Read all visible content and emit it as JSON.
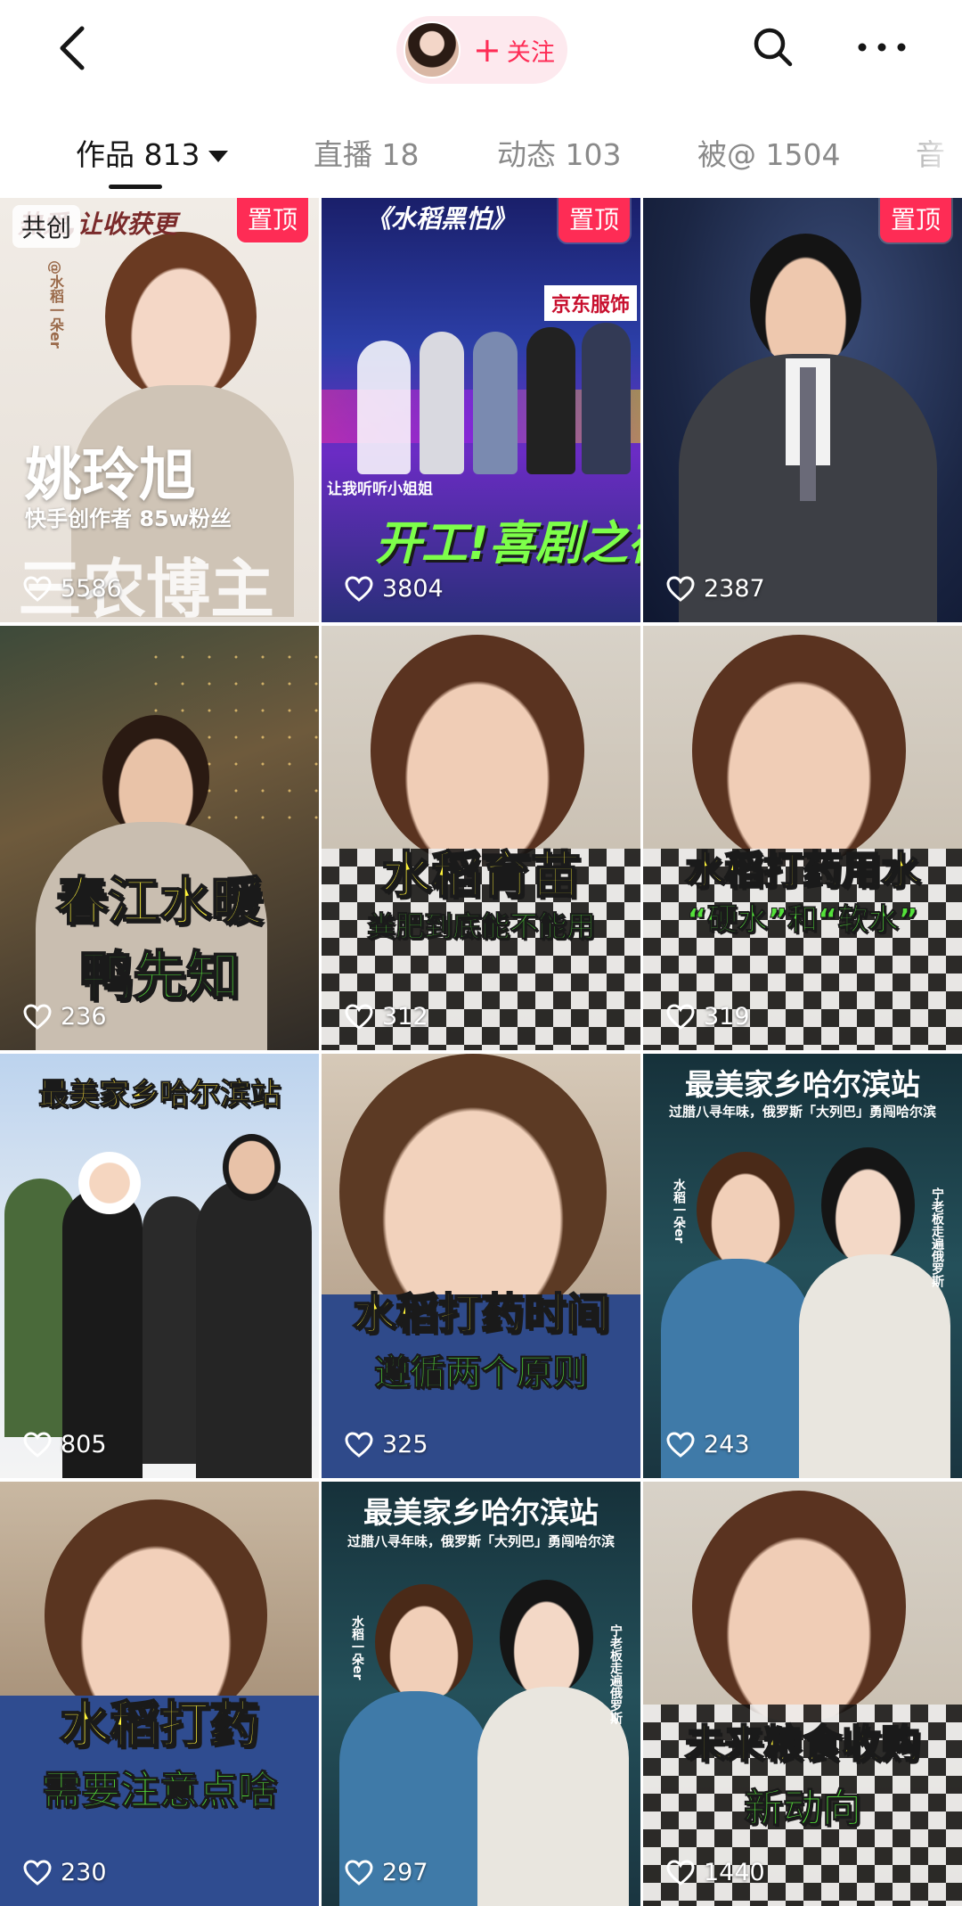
{
  "header": {
    "follow_label": "关注",
    "follow_plus": "+"
  },
  "colors": {
    "accent": "#fe2c55",
    "pill_bg": "#fde9ee"
  },
  "tabs": [
    {
      "label": "作品 813",
      "active": true
    },
    {
      "label": "直播 18"
    },
    {
      "label": "动态 103"
    },
    {
      "label": "被@ 1504"
    },
    {
      "label": "音"
    }
  ],
  "videos": [
    {
      "likes": "5586",
      "pinned": "置顶",
      "co_create": "共创",
      "texts": {
        "top": "热爱,让收获更",
        "name": "姚玲旭",
        "sub": "快手创作者  85w粉丝",
        "bottom": "三农博主",
        "vertical": "@水稻一朵er"
      }
    },
    {
      "likes": "3804",
      "pinned": "置顶",
      "texts": {
        "top": "《水稻黑怕》",
        "sign": "京东服饰",
        "mid": "让我听听小姐姐",
        "bottom": "开工!喜剧之夜"
      }
    },
    {
      "likes": "2387",
      "pinned": "置顶",
      "texts": {}
    },
    {
      "likes": "236",
      "texts": {
        "line1": "春江水暖",
        "line2": "鸭先知"
      }
    },
    {
      "likes": "312",
      "texts": {
        "line1": "水稻育苗",
        "line2": "粪肥到底能不能用"
      }
    },
    {
      "likes": "319",
      "texts": {
        "line1": "水稻打药用水",
        "line2": "“硬水”和“软水”"
      }
    },
    {
      "likes": "805",
      "texts": {
        "line1": "最美家乡哈尔滨站"
      }
    },
    {
      "likes": "325",
      "texts": {
        "line1": "水稻打药时间",
        "line2": "遵循两个原则"
      }
    },
    {
      "likes": "243",
      "texts": {
        "line1": "最美家乡哈尔滨站",
        "line2": "过腊八寻年味，俄罗斯「大列巴」勇闯哈尔滨",
        "tag_a": "水稻一朵er",
        "tag_b": "宁老板走遍俄罗斯"
      }
    },
    {
      "likes": "230",
      "texts": {
        "line1": "水稻打药",
        "line2": "需要注意点啥"
      }
    },
    {
      "likes": "297",
      "texts": {
        "line1": "最美家乡哈尔滨站",
        "line2": "过腊八寻年味，俄罗斯「大列巴」勇闯哈尔滨",
        "tag_a": "水稻一朵er",
        "tag_b": "宁老板走遍俄罗斯"
      }
    },
    {
      "likes": "1440",
      "texts": {
        "line1": "未来粮食收购",
        "line2": "新动向"
      }
    }
  ]
}
